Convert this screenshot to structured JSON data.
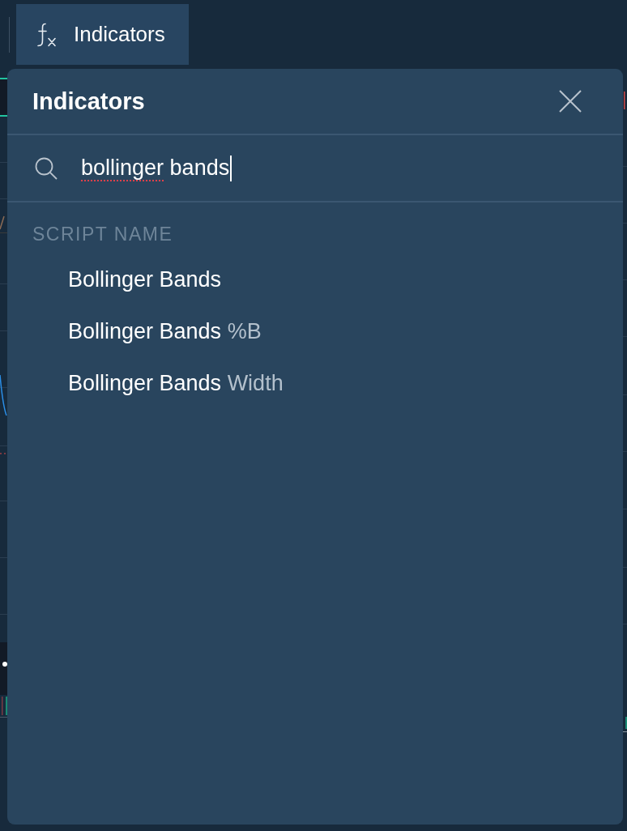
{
  "toolbar": {
    "button": {
      "label": "Indicators",
      "active": true
    }
  },
  "dialog": {
    "title": "Indicators",
    "search": {
      "words": [
        {
          "text": "bollinger",
          "misspelled": true
        },
        {
          "text": "bands",
          "misspelled": false
        }
      ],
      "focused": true
    },
    "section": {
      "heading": "SCRIPT NAME",
      "results": [
        {
          "name": "Bollinger Bands",
          "selected": false
        },
        {
          "name": "Bollinger Bands",
          "suffix": "%B",
          "selected": false
        },
        {
          "name": "Bollinger Bands",
          "suffix": "Width",
          "selected": false
        }
      ]
    }
  }
}
